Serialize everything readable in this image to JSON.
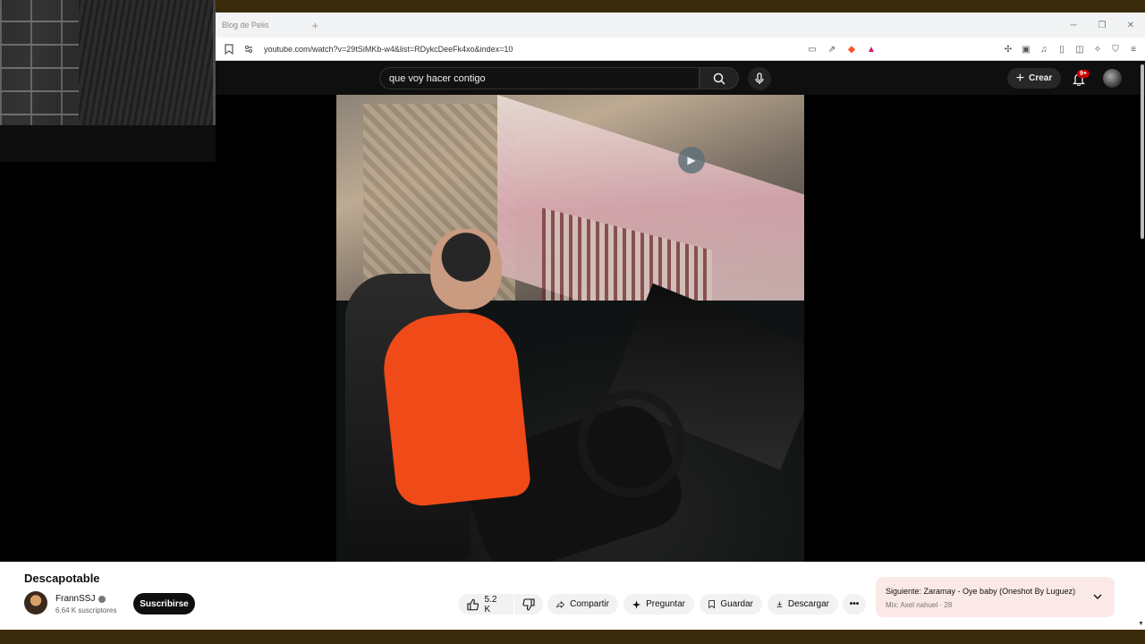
{
  "browser": {
    "tab_title": "Blog de Pelis",
    "new_tab": "+",
    "url": "youtube.com/watch?v=29tSiMKb-w4&list=RDykcDeeFk4xo&index=10",
    "minimize": "─",
    "restore": "❐",
    "close": "✕"
  },
  "youtube": {
    "search_query": "que voy hacer contigo",
    "create_label": "Crear",
    "notifications_badge": "9+"
  },
  "video": {
    "title": "Descapotable",
    "channel_name": "FrannSSJ",
    "subscribers": "6.64 K suscriptores",
    "subscribe_label": "Suscribirse",
    "likes": "5.2 K",
    "share_label": "Compartir",
    "ask_label": "Preguntar",
    "save_label": "Guardar",
    "download_label": "Descargar",
    "more_label": "•••"
  },
  "up_next": {
    "prefix": "Siguiente:",
    "title": "Zaramay - Oye baby (Oneshot By Luguez)",
    "mix": "Mix: Axel nahuel · 28"
  },
  "colors": {
    "accent_red": "#cc0000",
    "brave_orange": "#fb542b",
    "next_card_bg": "#fbe9e7"
  }
}
